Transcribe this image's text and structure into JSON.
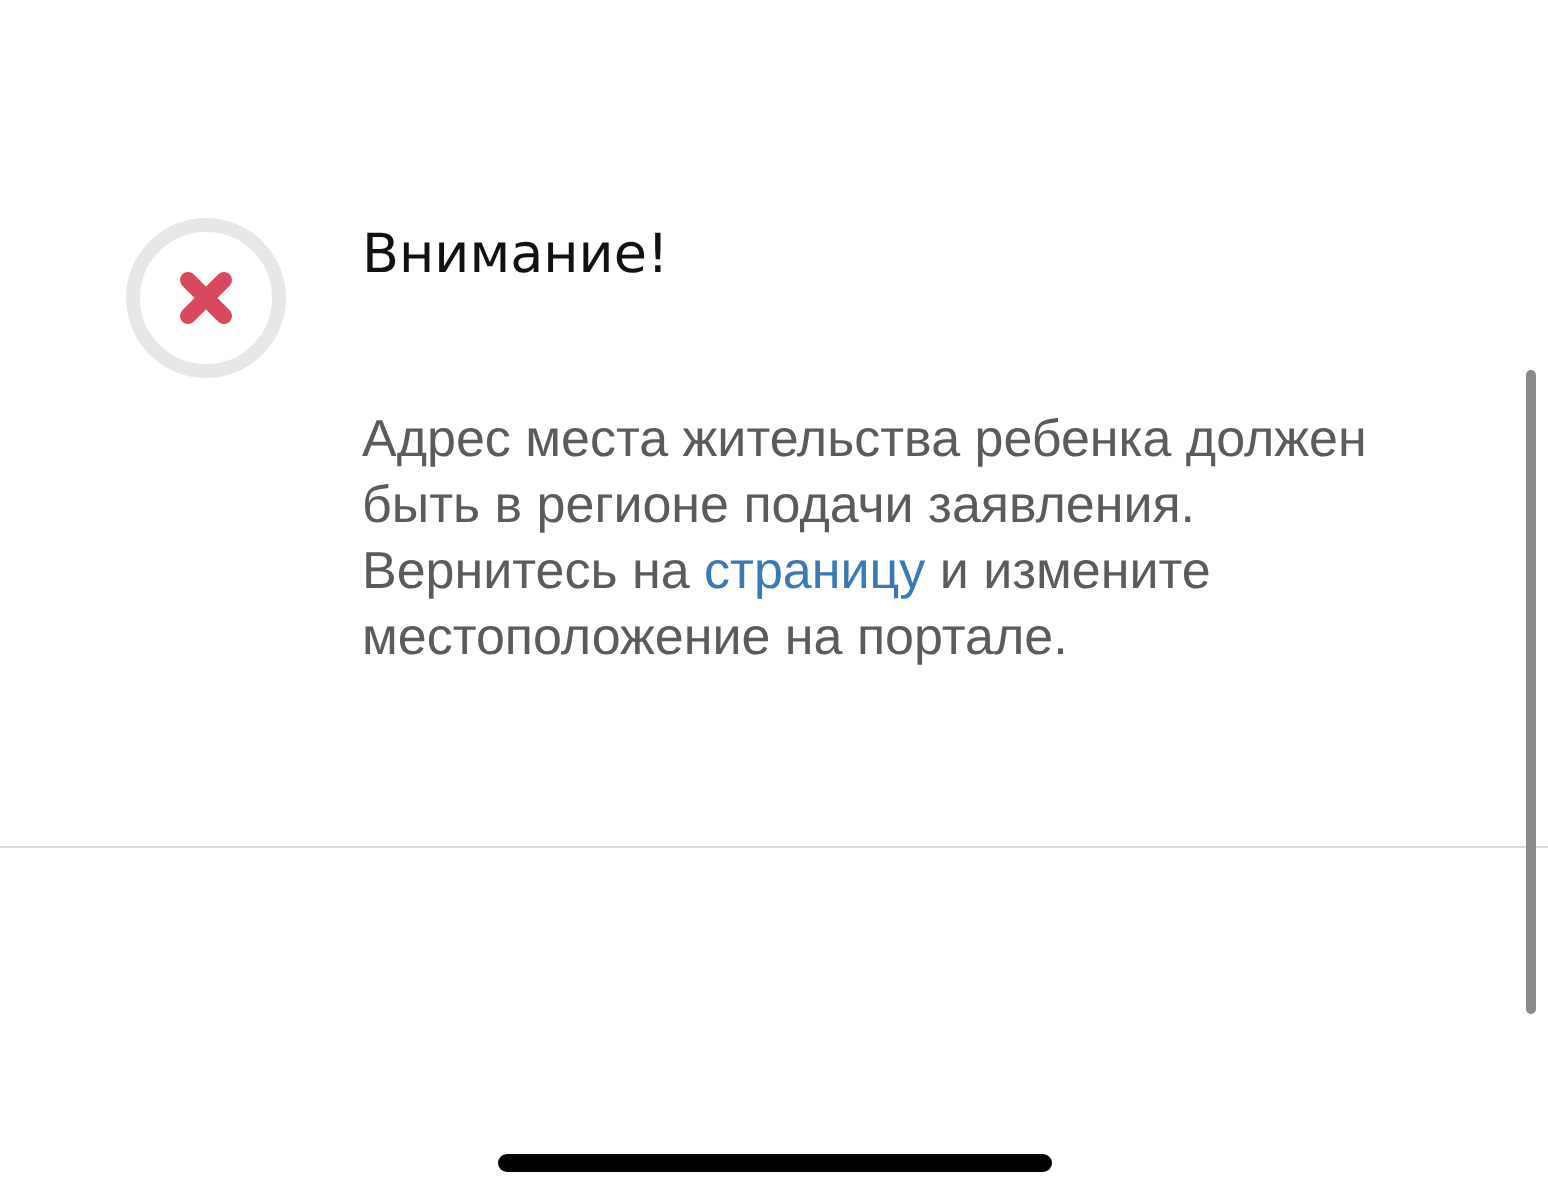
{
  "alert": {
    "title": "Внимание!",
    "message": {
      "text_before": "Адрес места жительства ребенка должен быть в регионе подачи заявления. Вернитесь на ",
      "link": "страницу",
      "text_after": " и измените местоположение на портале."
    }
  }
}
